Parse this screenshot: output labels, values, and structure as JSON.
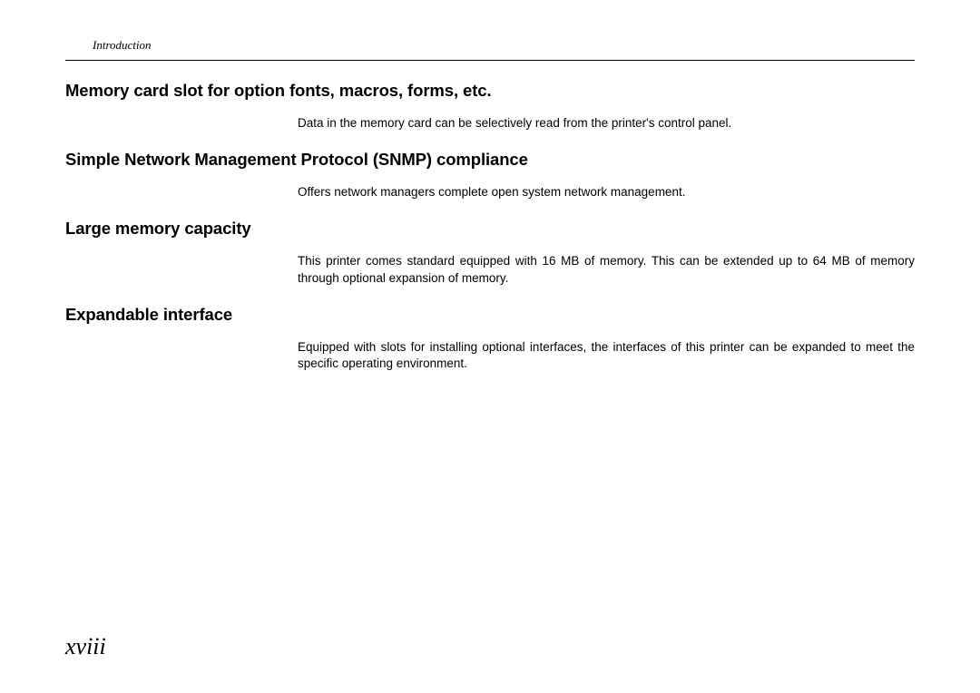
{
  "header": {
    "label": "Introduction"
  },
  "sections": [
    {
      "heading": "Memory card slot for option fonts, macros, forms, etc.",
      "body": "Data in the memory card can be selectively read from the printer's control panel."
    },
    {
      "heading": "Simple Network Management Protocol (SNMP) compliance",
      "body": "Offers network managers complete open system network management."
    },
    {
      "heading": "Large memory capacity",
      "body": "This printer comes standard equipped with 16 MB of memory.  This can be extended up to 64 MB of memory through optional expansion of memory."
    },
    {
      "heading": "Expandable interface",
      "body": "Equipped with slots for installing optional interfaces, the interfaces of this printer can be expanded to meet the specific operating environment."
    }
  ],
  "page_number": "xviii"
}
